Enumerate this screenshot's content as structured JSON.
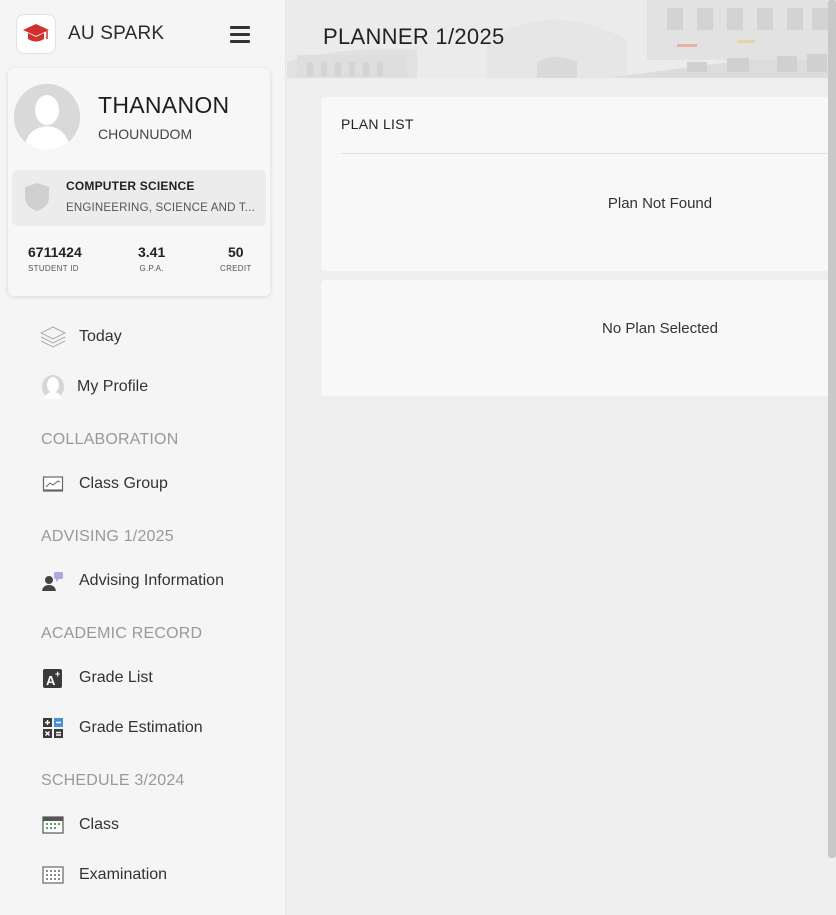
{
  "app": {
    "brand_name": "AU SPARK",
    "page_title": "PLANNER 1/2025"
  },
  "colors": {
    "brand_red": "#d32f2f",
    "sidebar_bg": "#f5f5f5",
    "section_title": "#999999"
  },
  "profile": {
    "first_name": "THANANON",
    "last_name": "CHOUNUDOM",
    "major": "COMPUTER SCIENCE",
    "faculty": "ENGINEERING, SCIENCE AND T...",
    "stats": {
      "student_id": {
        "value": "6711424",
        "label": "STUDENT ID"
      },
      "gpa": {
        "value": "3.41",
        "label": "G.P.A."
      },
      "credit": {
        "value": "50",
        "label": "CREDIT"
      }
    }
  },
  "nav": {
    "today": {
      "label": "Today",
      "icon": "layers-icon"
    },
    "my_profile": {
      "label": "My Profile",
      "icon": "user-silhouette-icon"
    },
    "collaboration": {
      "title": "COLLABORATION"
    },
    "class_group": {
      "label": "Class Group",
      "icon": "chart-icon"
    },
    "advising": {
      "title": "ADVISING 1/2025"
    },
    "advising_info": {
      "label": "Advising Information",
      "icon": "advisor-chat-icon"
    },
    "academic": {
      "title": "ACADEMIC RECORD"
    },
    "grade_list": {
      "label": "Grade List",
      "icon": "grade-a-plus-icon"
    },
    "grade_estimation": {
      "label": "Grade Estimation",
      "icon": "calculator-icon"
    },
    "schedule": {
      "title": "SCHEDULE 3/2024"
    },
    "class": {
      "label": "Class",
      "icon": "calendar-icon"
    },
    "examination": {
      "label": "Examination",
      "icon": "calendar-grid-icon"
    }
  },
  "main": {
    "plan_list": {
      "title": "PLAN LIST",
      "empty_message": "Plan Not Found"
    },
    "plan_detail": {
      "empty_message": "No Plan Selected"
    }
  }
}
